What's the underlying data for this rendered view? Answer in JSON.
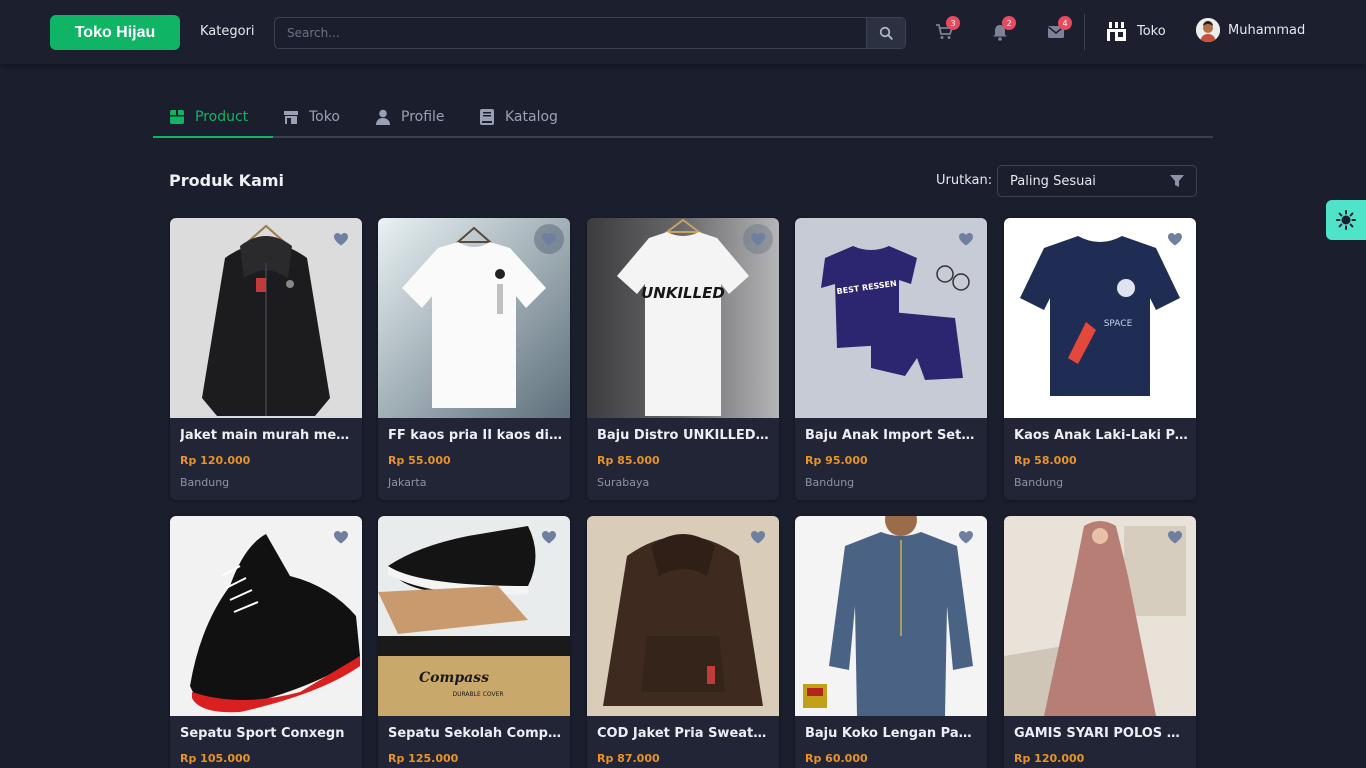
{
  "header": {
    "brand": "Toko Hijau",
    "kategori": "Kategori",
    "search_placeholder": "Search...",
    "cart_count": "3",
    "notif_count": "2",
    "mail_count": "4",
    "toko_label": "Toko",
    "user_name": "Muhammad"
  },
  "tabs": [
    {
      "label": "Product",
      "icon": "box-icon",
      "active": true
    },
    {
      "label": "Toko",
      "icon": "store-icon",
      "active": false
    },
    {
      "label": "Profile",
      "icon": "user-icon",
      "active": false
    },
    {
      "label": "Katalog",
      "icon": "book-icon",
      "active": false
    }
  ],
  "section": {
    "title": "Produk Kami",
    "sort_label": "Urutkan:",
    "sort_value": "Paling Sesuai"
  },
  "colors": {
    "accent": "#0fb565",
    "price": "#e8932a",
    "background": "#1b1e2d",
    "theme_button": "#4fe3c9"
  },
  "products": [
    {
      "name": "Jaket main murah meriah",
      "price": "Rp 120.000",
      "city": "Bandung"
    },
    {
      "name": "FF kaos pria II kaos distr...",
      "price": "Rp 55.000",
      "city": "Jakarta"
    },
    {
      "name": "Baju Distro UNKILLED Ka...",
      "price": "Rp 85.000",
      "city": "Surabaya"
    },
    {
      "name": "Baju Anak Import Setela...",
      "price": "Rp 95.000",
      "city": "Bandung"
    },
    {
      "name": "Kaos Anak Laki-Laki Pak...",
      "price": "Rp 58.000",
      "city": "Bandung"
    },
    {
      "name": "Sepatu Sport Conxegn",
      "price": "Rp 105.000",
      "city": ""
    },
    {
      "name": "Sepatu Sekolah Compas...",
      "price": "Rp 125.000",
      "city": ""
    },
    {
      "name": "COD Jaket Pria Sweater H...",
      "price": "Rp 87.000",
      "city": ""
    },
    {
      "name": "Baju Koko Lengan Panja...",
      "price": "Rp 60.000",
      "city": ""
    },
    {
      "name": "GAMIS SYARI POLOS MIR...",
      "price": "Rp 120.000",
      "city": ""
    }
  ],
  "image_text": {
    "unkilled": "UNKILLED",
    "best_ressen": "BEST RESSEN",
    "space": "SPACE",
    "compass": "Compass",
    "durable": "DURABLE COVER"
  }
}
